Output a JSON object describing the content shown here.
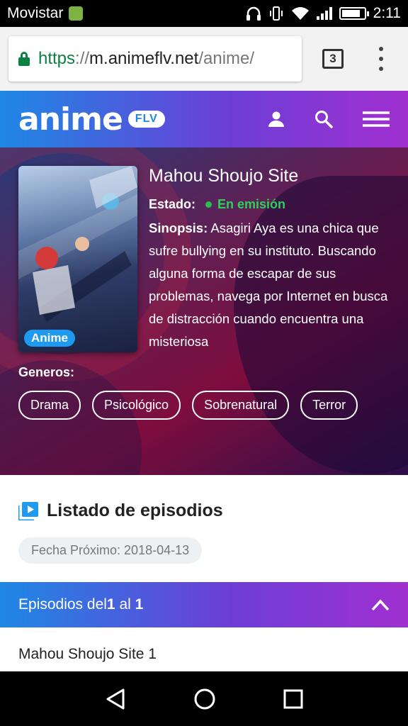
{
  "status_bar": {
    "carrier": "Movistar",
    "time": "2:11",
    "battery_fraction": 0.85
  },
  "browser": {
    "url_scheme": "https",
    "url_sep": "://",
    "url_host": "m.animeflv.net",
    "url_path": "/anime/",
    "tab_count": "3"
  },
  "site": {
    "logo_text": "anime",
    "logo_badge": "FLV"
  },
  "anime": {
    "title": "Mahou Shoujo Site",
    "estado_label": "Estado:",
    "estado_value": "En emisión",
    "sinopsis_label": "Sinopsis:",
    "sinopsis_text": " Asagiri Aya es una chica que sufre bullying en su instituto. Buscando alguna forma de escapar de sus problemas, navega por Internet en busca de distracción cuando encuentra una misteriosa",
    "type_badge": "Anime",
    "generos_label": "Generos:",
    "genres": [
      "Drama",
      "Psicológico",
      "Sobrenatural",
      "Terror"
    ]
  },
  "episodes_section": {
    "title": "Listado de episodios",
    "next_date": "Fecha Próximo: 2018-04-13",
    "range_prefix": "Episodios del ",
    "range_from": "1",
    "range_mid": " al ",
    "range_to": "1",
    "items": [
      "Mahou Shoujo Site 1"
    ]
  },
  "colors": {
    "brand_start": "#1e88e5",
    "brand_end": "#a12fd0",
    "status_green": "#2ed05a",
    "secure_green": "#0b8043"
  },
  "icons": [
    "android-icon",
    "headphones-icon",
    "vibrate-icon",
    "wifi-icon",
    "signal-icon",
    "battery-icon",
    "lock-icon",
    "tabs-icon",
    "more-icon",
    "user-icon",
    "search-icon",
    "hamburger-icon",
    "play-list-icon",
    "chevron-up-icon",
    "back-icon",
    "home-icon",
    "recents-icon"
  ]
}
